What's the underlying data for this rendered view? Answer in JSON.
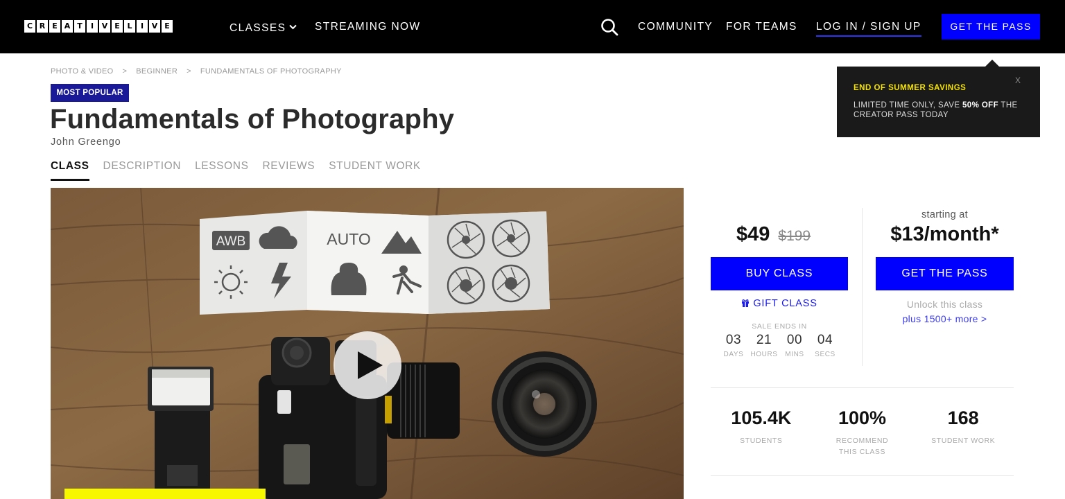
{
  "nav": {
    "logo_letters": [
      "C",
      "R",
      "E",
      "A",
      "T",
      "I",
      "V",
      "E",
      "L",
      "I",
      "V",
      "E"
    ],
    "classes_label": "CLASSES",
    "streaming_label": "STREAMING NOW",
    "community_label": "COMMUNITY",
    "teams_label": "FOR TEAMS",
    "login_label": "LOG IN / SIGN UP",
    "get_pass_label": "GET THE PASS",
    "icons": {
      "search": "search-icon",
      "dropdown": "chevron-down-icon"
    }
  },
  "breadcrumb": [
    "PHOTO & VIDEO",
    ">",
    "BEGINNER",
    ">",
    "FUNDAMENTALS OF PHOTOGRAPHY"
  ],
  "course": {
    "badge": "MOST POPULAR",
    "title": "Fundamentals of Photography",
    "author": "John Greengo"
  },
  "tabs": [
    "CLASS",
    "DESCRIPTION",
    "LESSONS",
    "REVIEWS",
    "STUDENT WORK"
  ],
  "hero": {
    "card_labels": {
      "awb": "AWB",
      "auto": "AUTO"
    },
    "play_icon": "play-icon"
  },
  "promo": {
    "title": "END OF SUMMER SAVINGS",
    "body_prefix": "LIMITED TIME ONLY, SAVE ",
    "body_bold": "50% OFF",
    "body_suffix": " THE CREATOR PASS TODAY",
    "close": "X"
  },
  "purchase": {
    "price": "$49",
    "old_price": "$199",
    "buy_label": "BUY CLASS",
    "gift_label": "GIFT CLASS",
    "gift_icon": "gift-icon",
    "sale_ends": "SALE ENDS IN",
    "countdown": [
      {
        "value": "03",
        "unit": "DAYS"
      },
      {
        "value": "21",
        "unit": "HOURS"
      },
      {
        "value": "00",
        "unit": "MINS"
      },
      {
        "value": "04",
        "unit": "SECS"
      }
    ],
    "starting_at": "starting at",
    "month_price": "$13/month*",
    "pass_label": "GET THE PASS",
    "unlock": "Unlock this class",
    "unlock_more": "plus 1500+ more >"
  },
  "stats": [
    {
      "value": "105.4K",
      "label": "STUDENTS"
    },
    {
      "value": "100%",
      "label": "RECOMMEND THIS CLASS"
    },
    {
      "value": "168",
      "label": "STUDENT WORK"
    }
  ],
  "colors": {
    "accent": "#0000ff",
    "badge": "#1a1a99",
    "promo_title": "#f5e200",
    "nav_bg": "#000000"
  }
}
